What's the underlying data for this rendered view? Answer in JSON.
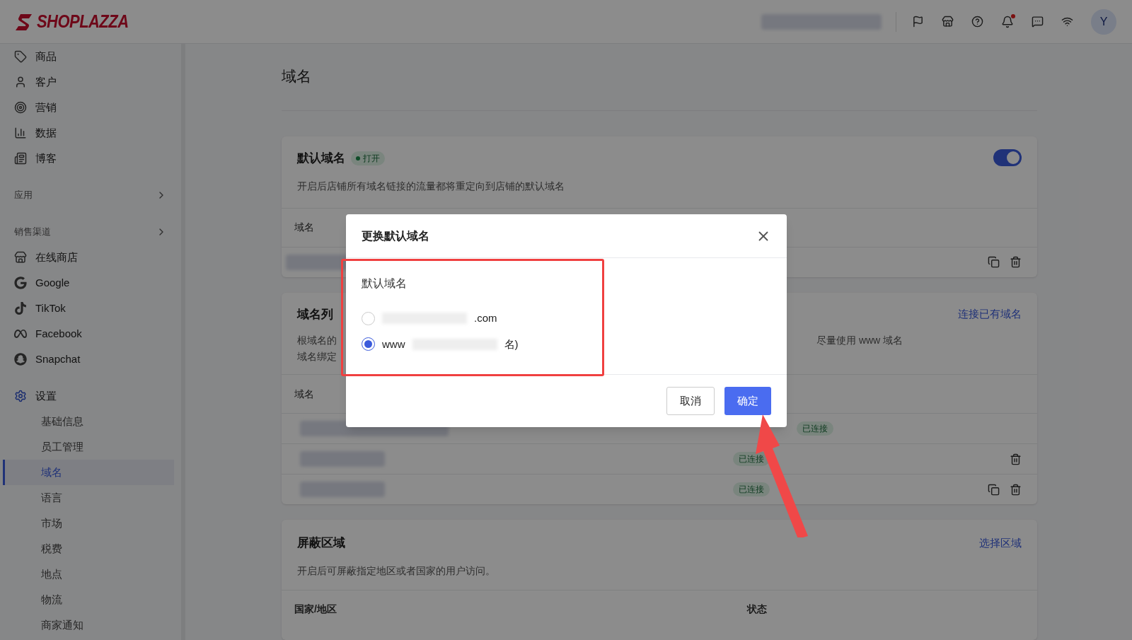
{
  "header": {
    "logo": "SHOPLAZZA",
    "avatar": "Y",
    "notification_dot": true
  },
  "sidebar": {
    "top_items": [
      {
        "label": "商品"
      },
      {
        "label": "客户"
      },
      {
        "label": "营销"
      },
      {
        "label": "数据"
      },
      {
        "label": "博客"
      }
    ],
    "apps": {
      "label": "应用"
    },
    "channels": {
      "label": "销售渠道",
      "items": [
        {
          "label": "在线商店"
        },
        {
          "label": "Google"
        },
        {
          "label": "TikTok"
        },
        {
          "label": "Facebook"
        },
        {
          "label": "Snapchat"
        }
      ]
    },
    "settings": {
      "label": "设置",
      "children": [
        {
          "label": "基础信息",
          "selected": false
        },
        {
          "label": "员工管理",
          "selected": false
        },
        {
          "label": "域名",
          "selected": true
        },
        {
          "label": "语言",
          "selected": false
        },
        {
          "label": "市场",
          "selected": false
        },
        {
          "label": "税费",
          "selected": false
        },
        {
          "label": "地点",
          "selected": false
        },
        {
          "label": "物流",
          "selected": false
        },
        {
          "label": "商家通知",
          "selected": false
        }
      ]
    }
  },
  "page": {
    "title": "域名",
    "default_domain_card": {
      "title": "默认域名",
      "badge": "打开",
      "on": true,
      "description": "开启后店铺所有域名链接的流量都将重定向到店铺的默认域名",
      "column_1": "域名"
    },
    "domain_list_card": {
      "title": "域名列",
      "description_left_1": "根域名的",
      "description_right_1": "尽量使用 www 域名",
      "description_left_2": "域名绑定",
      "link": "连接已有域名",
      "column_1": "域名",
      "rows": [
        {
          "status": "已连接",
          "copy": false,
          "delete": false
        },
        {
          "status": "已连接",
          "copy": false,
          "delete": true
        },
        {
          "status": "已连接",
          "copy": true,
          "delete": true
        }
      ]
    },
    "blocked_regions_card": {
      "title": "屏蔽区域",
      "link": "选择区域",
      "description": "开启后可屏蔽指定地区或者国家的用户访问。",
      "columns": [
        "国家/地区",
        "状态"
      ]
    }
  },
  "dialog": {
    "title": "更换默认域名",
    "label": "默认域名",
    "options": [
      {
        "text_after": ".com",
        "selected": false
      },
      {
        "text_before": "www",
        "text_after": "名)",
        "selected": true
      }
    ],
    "buttons": [
      {
        "label": "取消",
        "kind": "secondary"
      },
      {
        "label": "确定",
        "kind": "primary"
      }
    ]
  }
}
